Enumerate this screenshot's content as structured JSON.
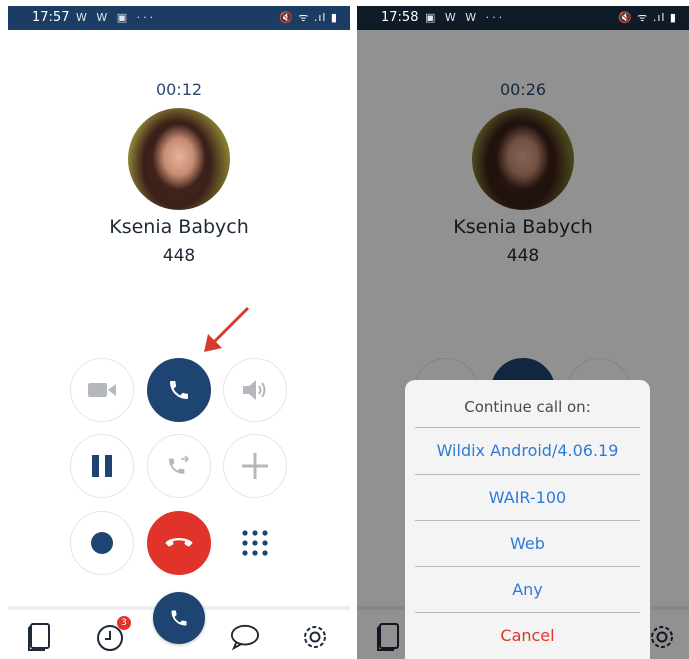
{
  "colors": {
    "brand_navy": "#1e4471",
    "status_bar": "#1b3d63",
    "hangup_red": "#e2332b",
    "option_blue": "#2f7bd7"
  },
  "left_screen": {
    "status_time": "17:57",
    "status_apps": "W W ▣ ···",
    "status_system": "🔇 ᯤ .ıl ▮",
    "timer": "00:12",
    "contact_name": "Ksenia Babych",
    "contact_extension": "448",
    "controls": [
      {
        "name": "video-button",
        "icon": "video-camera-icon"
      },
      {
        "name": "switch-device-button",
        "icon": "phone-handset-icon"
      },
      {
        "name": "speaker-button",
        "icon": "speaker-icon"
      },
      {
        "name": "hold-button",
        "icon": "pause-icon"
      },
      {
        "name": "transfer-button",
        "icon": "phone-transfer-icon"
      },
      {
        "name": "add-call-button",
        "icon": "plus-icon"
      },
      {
        "name": "record-button",
        "icon": "record-dot-icon"
      },
      {
        "name": "hangup-button",
        "icon": "end-call-icon"
      },
      {
        "name": "dialpad-button",
        "icon": "dialpad-icon"
      }
    ],
    "bottom_nav": {
      "items": [
        "phonebook-icon",
        "history-icon",
        "call-fab-icon",
        "chat-icon",
        "settings-icon"
      ],
      "history_badge": "3"
    },
    "annotation": "red-arrow-icon"
  },
  "right_screen": {
    "status_time": "17:58",
    "status_apps": "▣ W W ···",
    "status_system": "🔇 ᯤ .ıl ▮",
    "timer": "00:26",
    "contact_name": "Ksenia Babych",
    "contact_extension": "448",
    "dialog": {
      "title": "Continue call on:",
      "options": [
        "Wildix Android/4.06.19",
        "WAIR-100",
        "Web",
        "Any"
      ],
      "cancel": "Cancel"
    }
  }
}
